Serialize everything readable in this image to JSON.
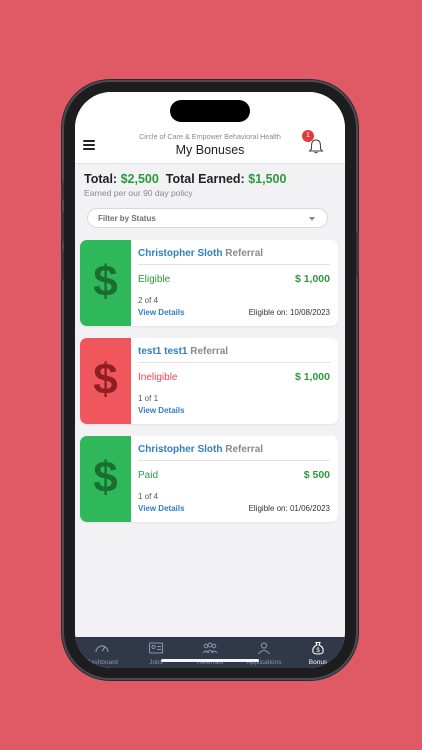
{
  "header": {
    "org": "Circle of Care & Empower Behavioral Health",
    "title": "My Bonuses",
    "notification_count": "1"
  },
  "summary": {
    "total_label": "Total:",
    "total_value": "$2,500",
    "earned_label": "Total Earned:",
    "earned_value": "$1,500",
    "policy": "Earned per our 90 day policy"
  },
  "filter": {
    "placeholder": "Filter by Status"
  },
  "bonuses": [
    {
      "name": "Christopher Sloth",
      "type": "Referral",
      "status": "Eligible",
      "amount": "$ 1,000",
      "count": "2 of 4",
      "details_label": "View Details",
      "eligible_on": "Eligible on: 10/08/2023",
      "color": "#2eb85a"
    },
    {
      "name": "test1 test1",
      "type": "Referral",
      "status": "Ineligible",
      "amount": "$ 1,000",
      "count": "1 of 1",
      "details_label": "View Details",
      "eligible_on": "",
      "color": "#f0575c"
    },
    {
      "name": "Christopher Sloth",
      "type": "Referral",
      "status": "Paid",
      "amount": "$ 500",
      "count": "1 of 4",
      "details_label": "View Details",
      "eligible_on": "Eligible on: 01/06/2023",
      "color": "#2eb85a"
    }
  ],
  "tabs": [
    {
      "label": "Dashboard",
      "icon": "gauge-icon"
    },
    {
      "label": "Jobs",
      "icon": "id-card-icon"
    },
    {
      "label": "Referrals",
      "icon": "people-icon"
    },
    {
      "label": "Applications",
      "icon": "person-icon"
    },
    {
      "label": "Bonus",
      "icon": "money-bag-icon",
      "active": true
    }
  ]
}
